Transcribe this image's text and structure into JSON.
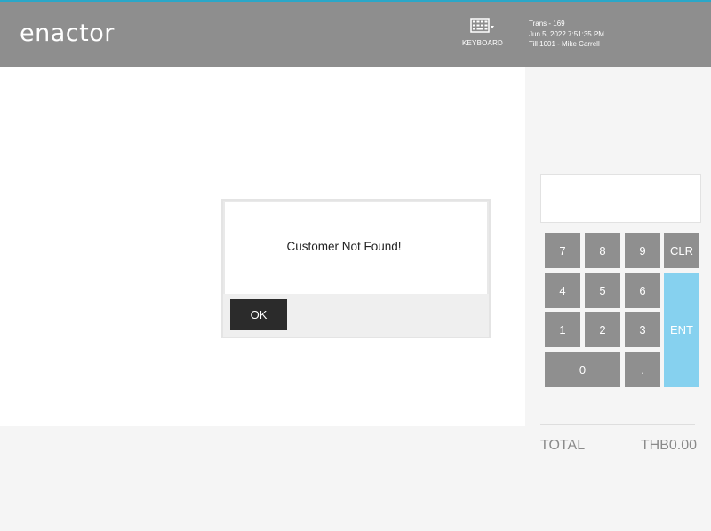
{
  "header": {
    "logo_text": "enactor",
    "keyboard_label": "KEYBOARD",
    "trans": "Trans - 169",
    "datetime": "Jun 5, 2022 7:51:35 PM",
    "till": "Till 1001 - Mike Carrell"
  },
  "dialog": {
    "message": "Customer Not Found!",
    "ok_label": "OK"
  },
  "keypad": {
    "k7": "7",
    "k8": "8",
    "k9": "9",
    "clr": "CLR",
    "k4": "4",
    "k5": "5",
    "k6": "6",
    "ent": "ENT",
    "k1": "1",
    "k2": "2",
    "k3": "3",
    "k0": "0",
    "dot": "."
  },
  "totals": {
    "label": "TOTAL",
    "value": "THB0.00"
  },
  "colors": {
    "header_bg": "#8e8e8e",
    "accent": "#2aa7c8",
    "key_bg": "#8f8f8f",
    "ent_bg": "#86d1ef",
    "ok_bg": "#2b2b2b"
  }
}
